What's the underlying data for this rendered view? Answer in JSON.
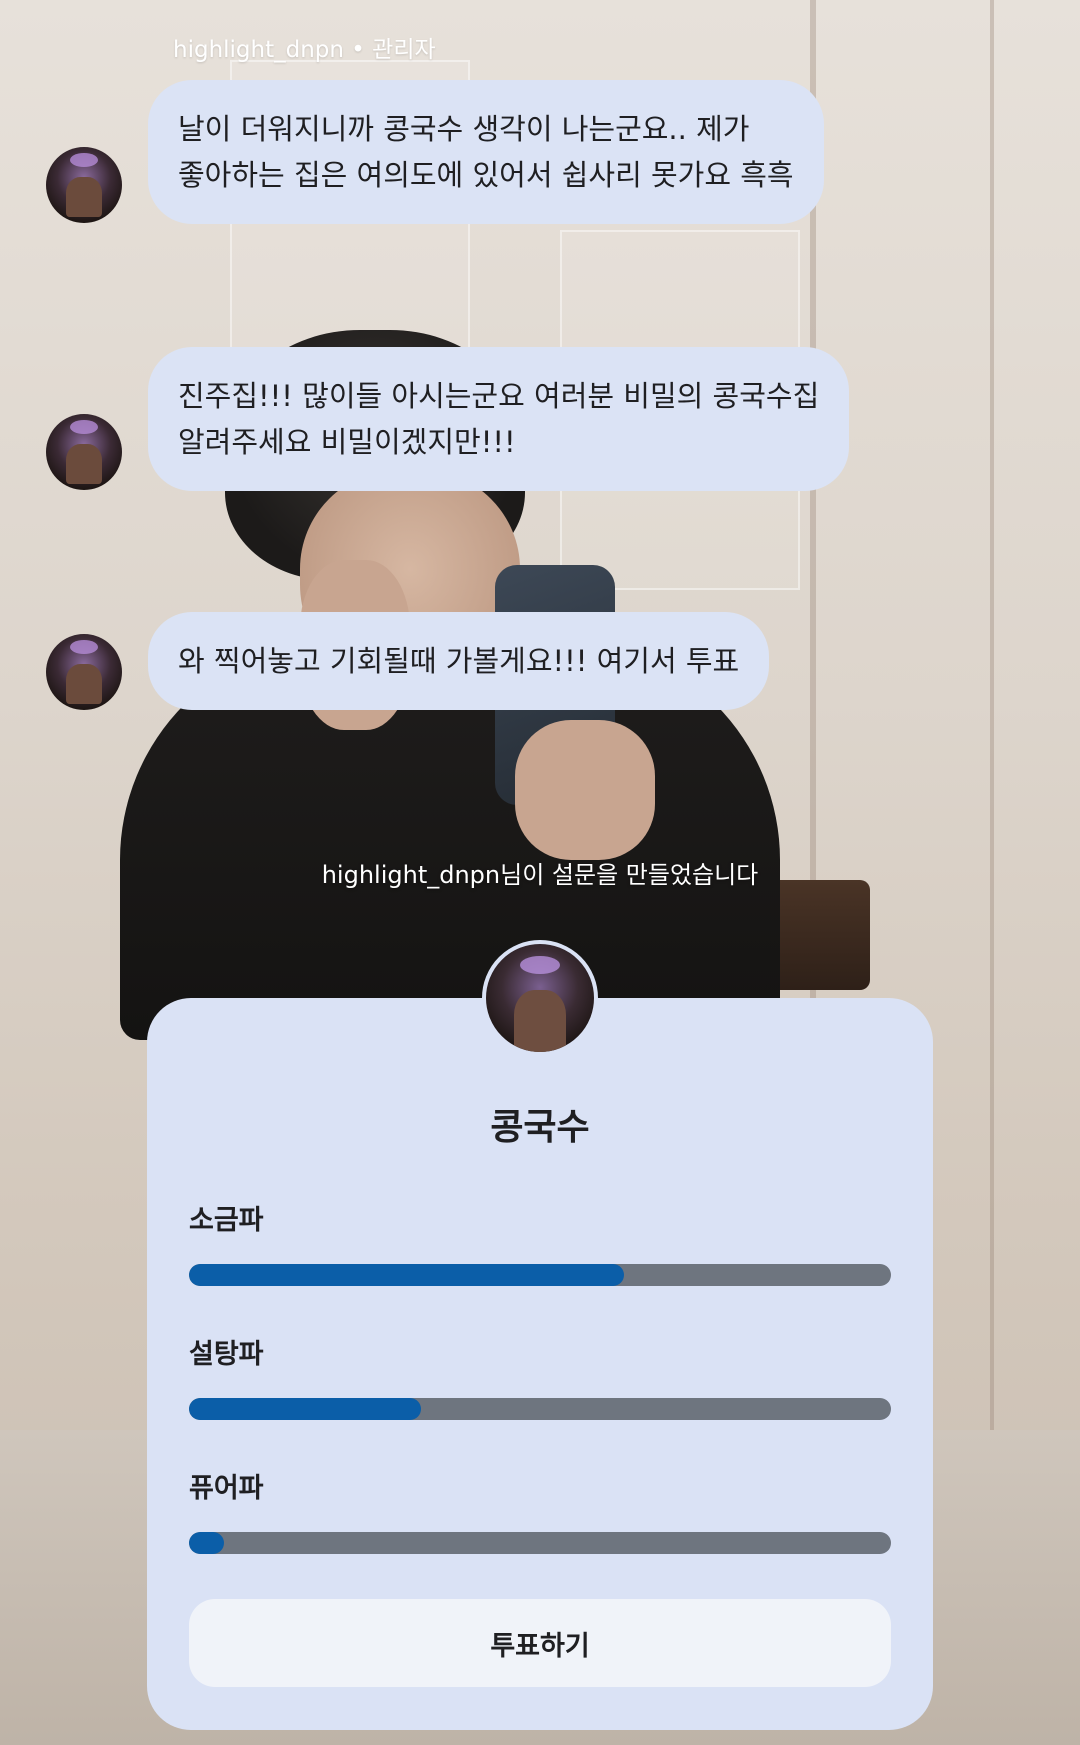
{
  "chat": {
    "sender": "highlight_dnpn • 관리자",
    "messages": [
      {
        "text": "날이 더워지니까 콩국수 생각이 나는군요.. 제가\n좋아하는 집은 여의도에 있어서 쉽사리 못가요 흑흑"
      },
      {
        "text": "진주집!!! 많이들 아시는군요 여러분 비밀의 콩국수집\n알려주세요 비밀이겠지만!!!"
      },
      {
        "text": "와 찍어놓고 기회될때 가볼게요!!! 여기서 투표"
      }
    ],
    "system_message": "highlight_dnpn님이 설문을 만들었습니다"
  },
  "poll": {
    "title": "콩국수",
    "options": [
      {
        "label": "소금파",
        "fraction": 0.62
      },
      {
        "label": "설탕파",
        "fraction": 0.33
      },
      {
        "label": "퓨어파",
        "fraction": 0.05
      }
    ],
    "vote_button": "투표하기"
  },
  "colors": {
    "bubble": "#dbe3f5",
    "bar_fill": "#0b5ea8",
    "bar_track": "#6e757f"
  }
}
